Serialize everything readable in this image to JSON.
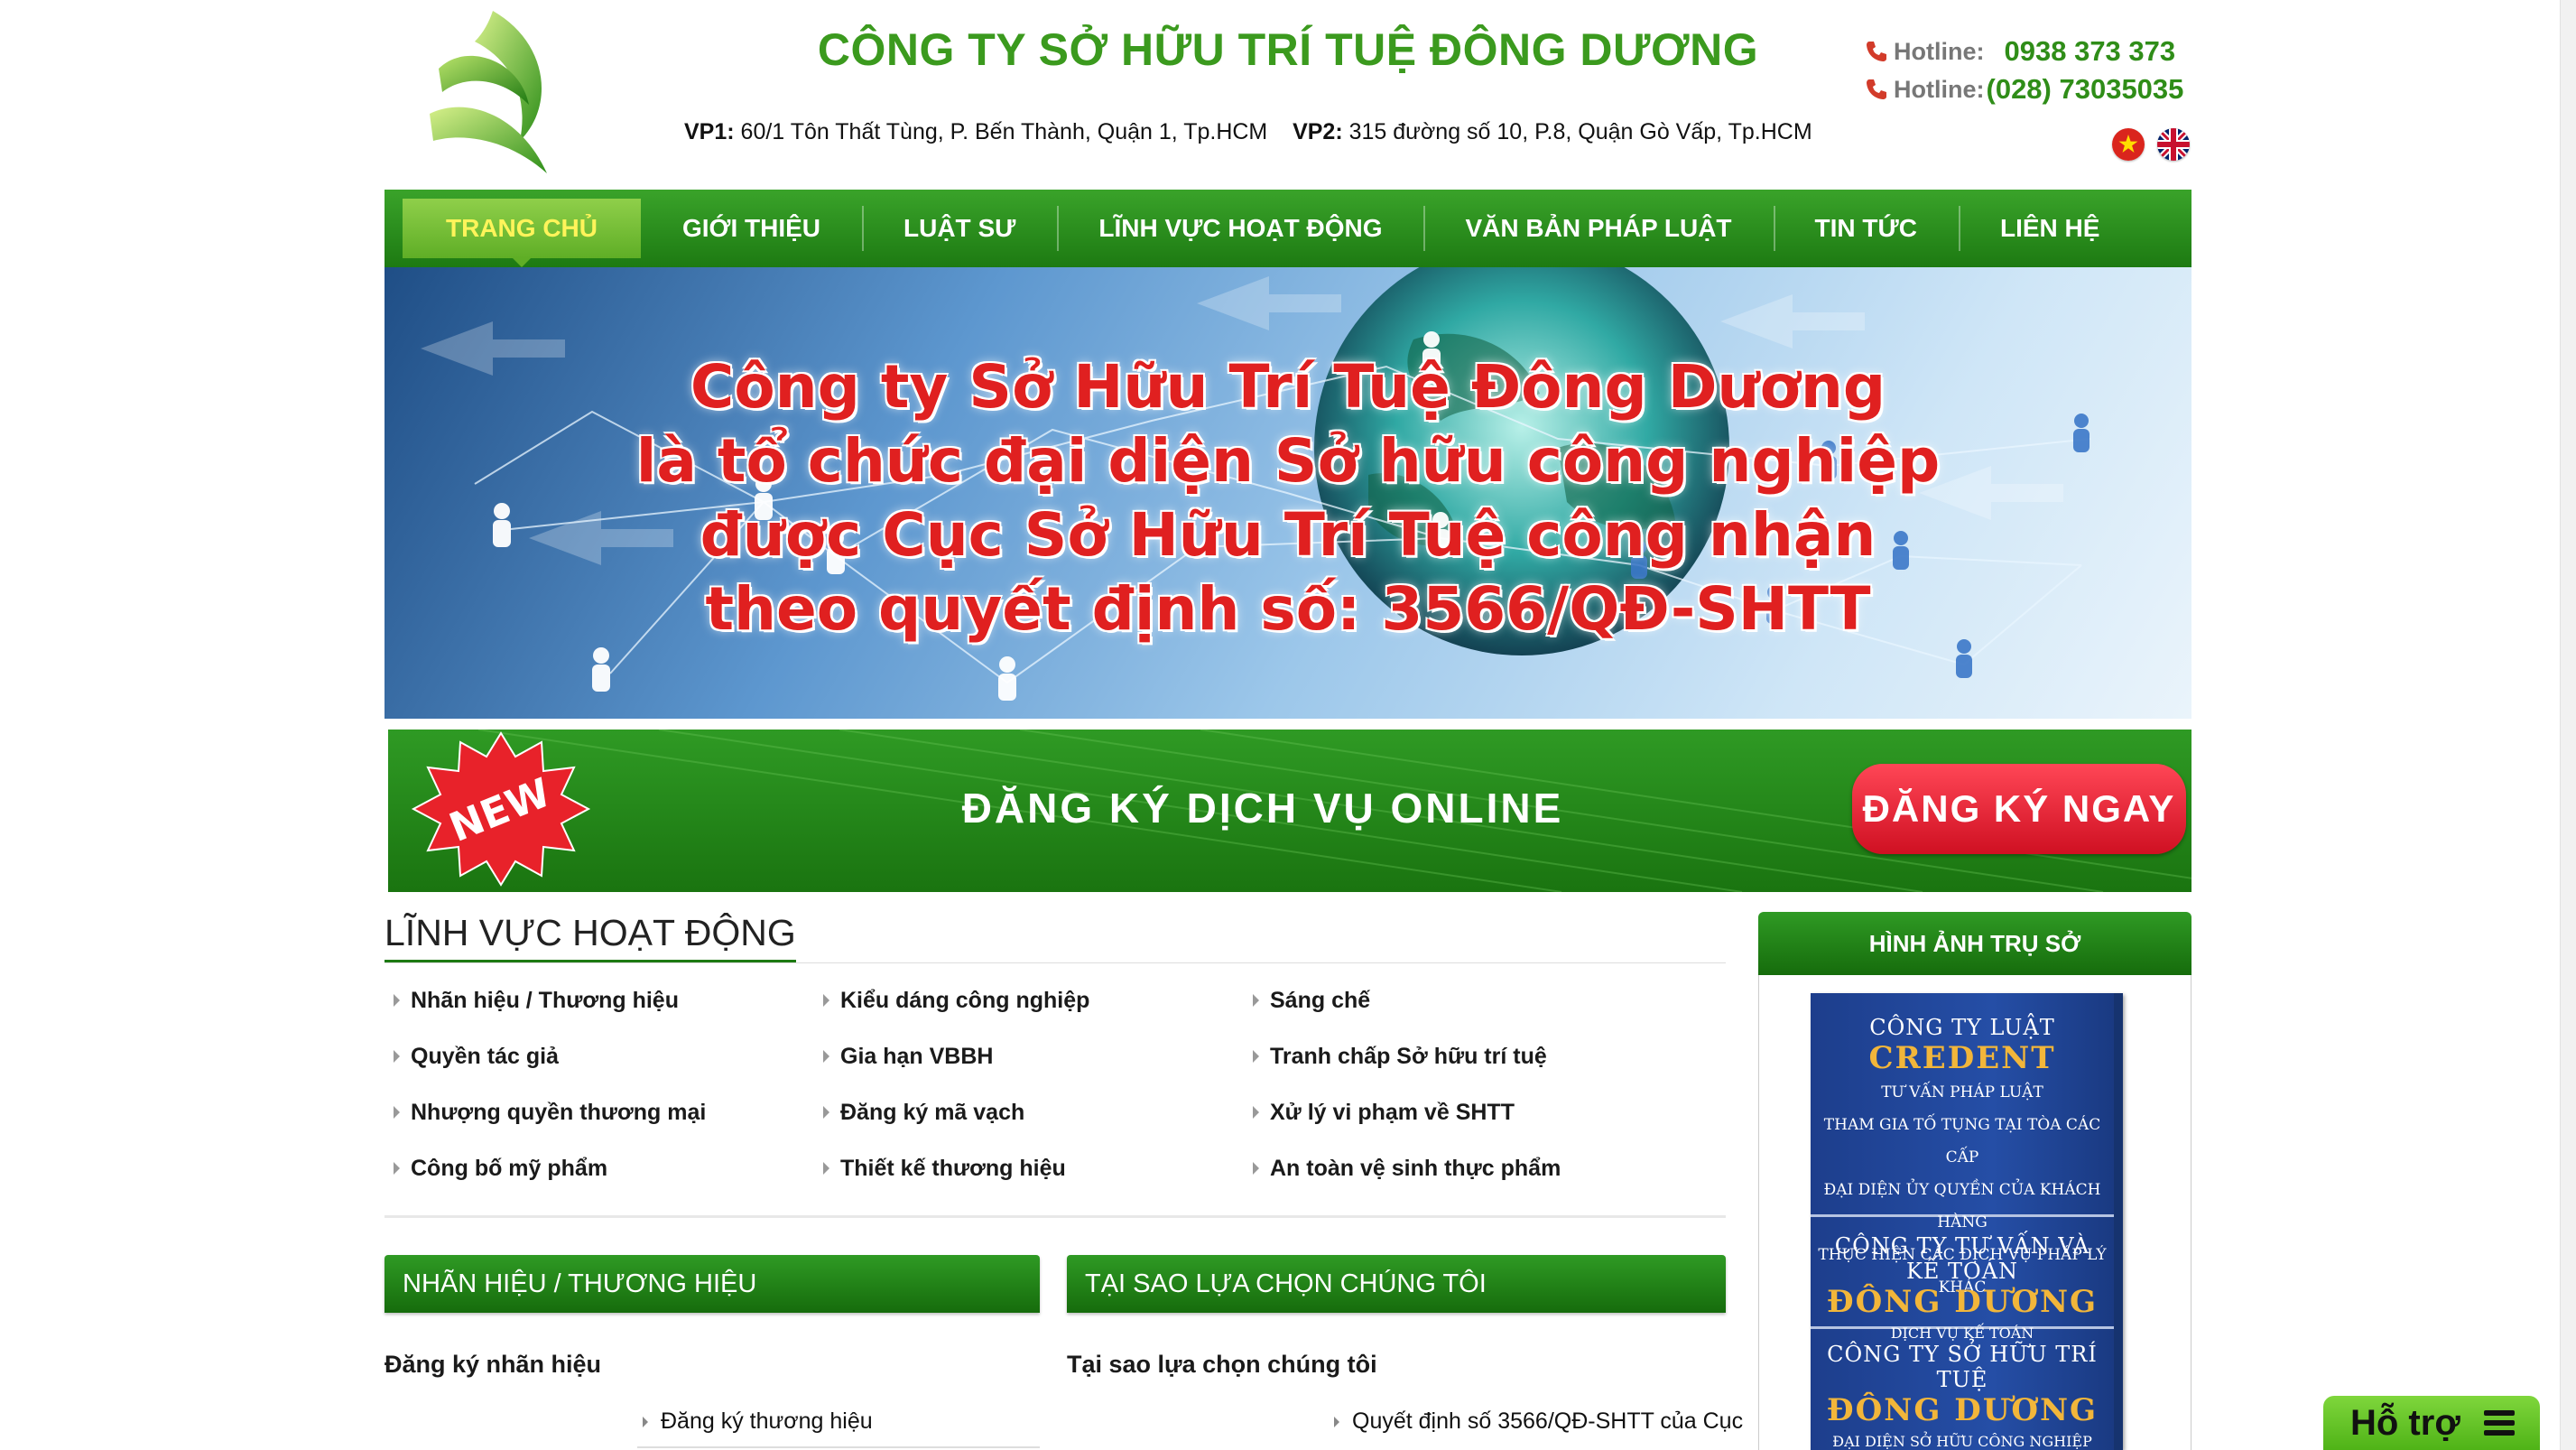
{
  "header": {
    "company_name": "CÔNG TY SỞ HỮU TRÍ TUỆ ĐÔNG DƯƠNG",
    "vp1_label": "VP1:",
    "vp1_address": " 60/1 Tôn Thất Tùng, P. Bến Thành, Quận 1,  Tp.HCM",
    "vp2_label": "VP2:",
    "vp2_address": " 315 đường số 10, P.8, Quận Gò Vấp, Tp.HCM",
    "hotlines": [
      {
        "label": "Hotline:",
        "number": "0938 373 373"
      },
      {
        "label": "Hotline:",
        "number": "(028) 73035035"
      }
    ],
    "languages": [
      "vi-flag-icon",
      "uk-flag-icon"
    ]
  },
  "nav": {
    "items": [
      {
        "label": "TRANG CHỦ",
        "active": true
      },
      {
        "label": "GIỚI THIỆU"
      },
      {
        "label": "LUẬT SƯ"
      },
      {
        "label": "LĨNH VỰC HOẠT ĐỘNG"
      },
      {
        "label": "VĂN BẢN PHÁP LUẬT"
      },
      {
        "label": "TIN TỨC"
      },
      {
        "label": "LIÊN HỆ"
      }
    ]
  },
  "banner": {
    "lines": [
      "Công ty Sở Hữu Trí Tuệ Đông Dương",
      "là tổ chức đại diện Sở hữu công nghiệp",
      "được Cục Sở Hữu Trí Tuệ công nhận",
      "theo quyết định số: 3566/QĐ-SHTT"
    ]
  },
  "online": {
    "badge": "NEW",
    "title": "ĐĂNG KÝ DỊCH VỤ ONLINE",
    "button": "ĐĂNG KÝ NGAY"
  },
  "fields": {
    "title": "LĨNH VỰC HOẠT ĐỘNG",
    "items": [
      "Nhãn hiệu / Thương hiệu",
      "Kiểu dáng công nghiệp",
      "Sáng chế",
      "Quyền tác giả",
      "Gia hạn VBBH",
      "Tranh chấp Sở hữu trí tuệ",
      "Nhượng quyền thương mại",
      "Đăng ký mã vạch",
      "Xử lý vi phạm về SHTT",
      "Công bố mỹ phẩm",
      "Thiết kế thương hiệu",
      "An toàn vệ sinh thực phẩm"
    ]
  },
  "boxes": [
    {
      "title": "NHÃN HIỆU / THƯƠNG HIỆU",
      "subtitle": "Đăng ký nhãn hiệu",
      "link": "Đăng ký thương hiệu"
    },
    {
      "title": "TẠI SAO LỰA CHỌN CHÚNG TÔI",
      "subtitle": "Tại sao lựa chọn chúng tôi",
      "link": "Quyết định số 3566/QĐ-SHTT của Cục"
    }
  ],
  "sidebar": {
    "title": "HÌNH ẢNH TRỤ SỞ",
    "board": {
      "s1_title": "CÔNG TY LUẬT",
      "s1_brand": "CREDENT",
      "s1_lines": [
        "TƯ VẤN PHÁP LUẬT",
        "THAM GIA TỐ TỤNG TẠI TÒA CÁC CẤP",
        "ĐẠI DIỆN ỦY QUYỀN CỦA KHÁCH HÀNG",
        "THỰC HIỆN CÁC DỊCH VỤ PHÁP LÝ KHÁC"
      ],
      "s2_title": "CÔNG TY TƯ VẤN VÀ KẾ TOÁN",
      "s2_brand": "ĐÔNG DƯƠNG",
      "s2_line": "DỊCH VỤ KẾ TOÁN",
      "s3_title": "CÔNG TY SỞ HỮU TRÍ TUỆ",
      "s3_brand": "ĐÔNG DƯƠNG",
      "s3_line": "ĐẠI DIỆN SỞ HỮU CÔNG NGHIỆP"
    }
  },
  "support": {
    "label": "Hỗ trợ"
  },
  "colors": {
    "brand_green": "#3b9a1e",
    "nav_green": "#1d7a12",
    "accent_red": "#e02020",
    "hotline_green": "#2f8d18"
  }
}
